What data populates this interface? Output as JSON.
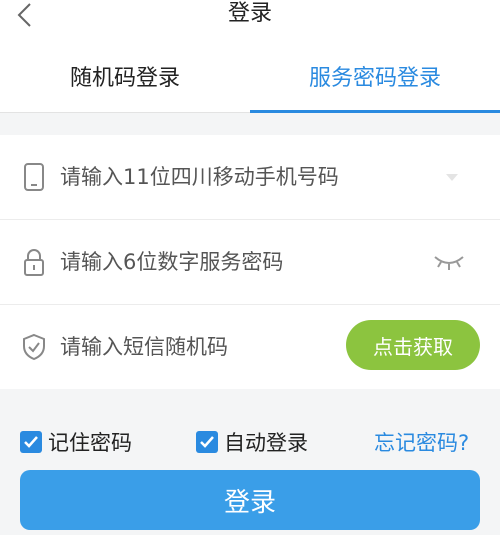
{
  "header": {
    "title": "登录",
    "back_icon": "chevron-left-icon"
  },
  "tabs": [
    {
      "label": "随机码登录",
      "active": false
    },
    {
      "label": "服务密码登录",
      "active": true
    }
  ],
  "form": {
    "phone": {
      "placeholder": "请输入11位四川移动手机号码",
      "icon": "phone-icon",
      "trailing_icon": "chevron-down-icon"
    },
    "password": {
      "placeholder": "请输入6位数字服务密码",
      "icon": "lock-icon",
      "trailing_icon": "eye-closed-icon"
    },
    "sms_code": {
      "placeholder": "请输入短信随机码",
      "icon": "shield-check-icon",
      "button_label": "点击获取"
    }
  },
  "options": {
    "remember_password": {
      "label": "记住密码",
      "checked": true
    },
    "auto_login": {
      "label": "自动登录",
      "checked": true
    },
    "forgot_password": "忘记密码?"
  },
  "login_button": "登录",
  "colors": {
    "accent": "#2a8ae0",
    "login_button": "#3a9ee8",
    "sms_button": "#8cc43f",
    "background": "#f4f5f6"
  }
}
